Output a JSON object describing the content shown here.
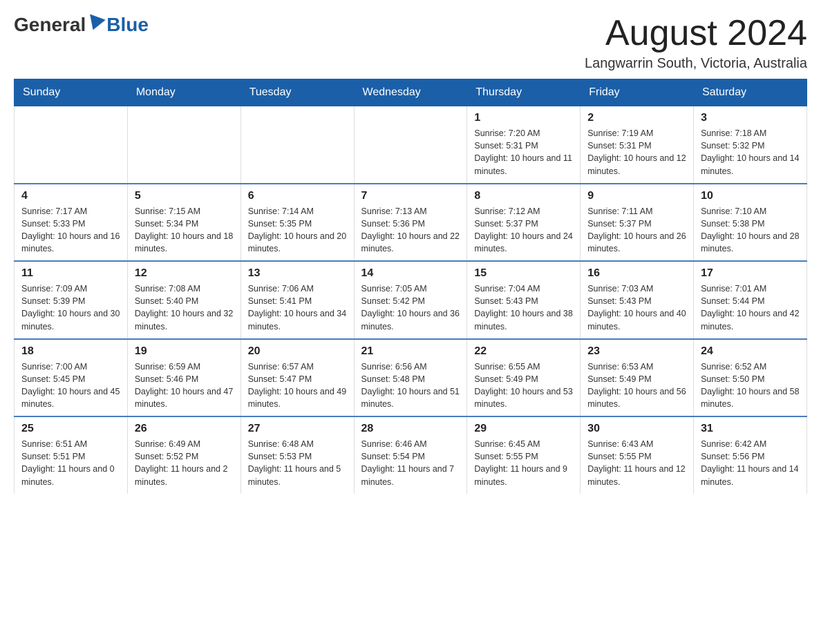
{
  "header": {
    "logo_general": "General",
    "logo_blue": "Blue",
    "title": "August 2024",
    "subtitle": "Langwarrin South, Victoria, Australia"
  },
  "weekdays": [
    "Sunday",
    "Monday",
    "Tuesday",
    "Wednesday",
    "Thursday",
    "Friday",
    "Saturday"
  ],
  "weeks": [
    [
      {
        "day": "",
        "info": ""
      },
      {
        "day": "",
        "info": ""
      },
      {
        "day": "",
        "info": ""
      },
      {
        "day": "",
        "info": ""
      },
      {
        "day": "1",
        "info": "Sunrise: 7:20 AM\nSunset: 5:31 PM\nDaylight: 10 hours and 11 minutes."
      },
      {
        "day": "2",
        "info": "Sunrise: 7:19 AM\nSunset: 5:31 PM\nDaylight: 10 hours and 12 minutes."
      },
      {
        "day": "3",
        "info": "Sunrise: 7:18 AM\nSunset: 5:32 PM\nDaylight: 10 hours and 14 minutes."
      }
    ],
    [
      {
        "day": "4",
        "info": "Sunrise: 7:17 AM\nSunset: 5:33 PM\nDaylight: 10 hours and 16 minutes."
      },
      {
        "day": "5",
        "info": "Sunrise: 7:15 AM\nSunset: 5:34 PM\nDaylight: 10 hours and 18 minutes."
      },
      {
        "day": "6",
        "info": "Sunrise: 7:14 AM\nSunset: 5:35 PM\nDaylight: 10 hours and 20 minutes."
      },
      {
        "day": "7",
        "info": "Sunrise: 7:13 AM\nSunset: 5:36 PM\nDaylight: 10 hours and 22 minutes."
      },
      {
        "day": "8",
        "info": "Sunrise: 7:12 AM\nSunset: 5:37 PM\nDaylight: 10 hours and 24 minutes."
      },
      {
        "day": "9",
        "info": "Sunrise: 7:11 AM\nSunset: 5:37 PM\nDaylight: 10 hours and 26 minutes."
      },
      {
        "day": "10",
        "info": "Sunrise: 7:10 AM\nSunset: 5:38 PM\nDaylight: 10 hours and 28 minutes."
      }
    ],
    [
      {
        "day": "11",
        "info": "Sunrise: 7:09 AM\nSunset: 5:39 PM\nDaylight: 10 hours and 30 minutes."
      },
      {
        "day": "12",
        "info": "Sunrise: 7:08 AM\nSunset: 5:40 PM\nDaylight: 10 hours and 32 minutes."
      },
      {
        "day": "13",
        "info": "Sunrise: 7:06 AM\nSunset: 5:41 PM\nDaylight: 10 hours and 34 minutes."
      },
      {
        "day": "14",
        "info": "Sunrise: 7:05 AM\nSunset: 5:42 PM\nDaylight: 10 hours and 36 minutes."
      },
      {
        "day": "15",
        "info": "Sunrise: 7:04 AM\nSunset: 5:43 PM\nDaylight: 10 hours and 38 minutes."
      },
      {
        "day": "16",
        "info": "Sunrise: 7:03 AM\nSunset: 5:43 PM\nDaylight: 10 hours and 40 minutes."
      },
      {
        "day": "17",
        "info": "Sunrise: 7:01 AM\nSunset: 5:44 PM\nDaylight: 10 hours and 42 minutes."
      }
    ],
    [
      {
        "day": "18",
        "info": "Sunrise: 7:00 AM\nSunset: 5:45 PM\nDaylight: 10 hours and 45 minutes."
      },
      {
        "day": "19",
        "info": "Sunrise: 6:59 AM\nSunset: 5:46 PM\nDaylight: 10 hours and 47 minutes."
      },
      {
        "day": "20",
        "info": "Sunrise: 6:57 AM\nSunset: 5:47 PM\nDaylight: 10 hours and 49 minutes."
      },
      {
        "day": "21",
        "info": "Sunrise: 6:56 AM\nSunset: 5:48 PM\nDaylight: 10 hours and 51 minutes."
      },
      {
        "day": "22",
        "info": "Sunrise: 6:55 AM\nSunset: 5:49 PM\nDaylight: 10 hours and 53 minutes."
      },
      {
        "day": "23",
        "info": "Sunrise: 6:53 AM\nSunset: 5:49 PM\nDaylight: 10 hours and 56 minutes."
      },
      {
        "day": "24",
        "info": "Sunrise: 6:52 AM\nSunset: 5:50 PM\nDaylight: 10 hours and 58 minutes."
      }
    ],
    [
      {
        "day": "25",
        "info": "Sunrise: 6:51 AM\nSunset: 5:51 PM\nDaylight: 11 hours and 0 minutes."
      },
      {
        "day": "26",
        "info": "Sunrise: 6:49 AM\nSunset: 5:52 PM\nDaylight: 11 hours and 2 minutes."
      },
      {
        "day": "27",
        "info": "Sunrise: 6:48 AM\nSunset: 5:53 PM\nDaylight: 11 hours and 5 minutes."
      },
      {
        "day": "28",
        "info": "Sunrise: 6:46 AM\nSunset: 5:54 PM\nDaylight: 11 hours and 7 minutes."
      },
      {
        "day": "29",
        "info": "Sunrise: 6:45 AM\nSunset: 5:55 PM\nDaylight: 11 hours and 9 minutes."
      },
      {
        "day": "30",
        "info": "Sunrise: 6:43 AM\nSunset: 5:55 PM\nDaylight: 11 hours and 12 minutes."
      },
      {
        "day": "31",
        "info": "Sunrise: 6:42 AM\nSunset: 5:56 PM\nDaylight: 11 hours and 14 minutes."
      }
    ]
  ]
}
